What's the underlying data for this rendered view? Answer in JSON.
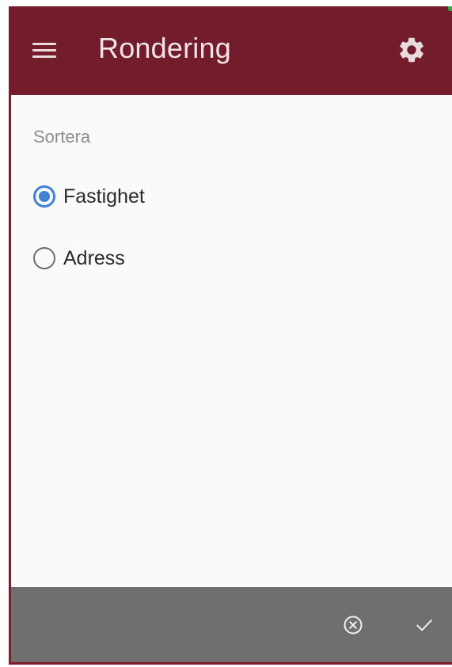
{
  "appbar": {
    "title": "Rondering",
    "menu_icon": "menu-icon",
    "settings_icon": "gear-icon",
    "color": "#721c2c"
  },
  "sort": {
    "label": "Sortera",
    "options": [
      {
        "label": "Fastighet",
        "selected": true
      },
      {
        "label": "Adress",
        "selected": false
      }
    ],
    "accent_color": "#3f82d3"
  },
  "bottombar": {
    "cancel_icon": "cancel-circle-icon",
    "confirm_icon": "checkmark-icon",
    "color": "#6f6f6f"
  }
}
